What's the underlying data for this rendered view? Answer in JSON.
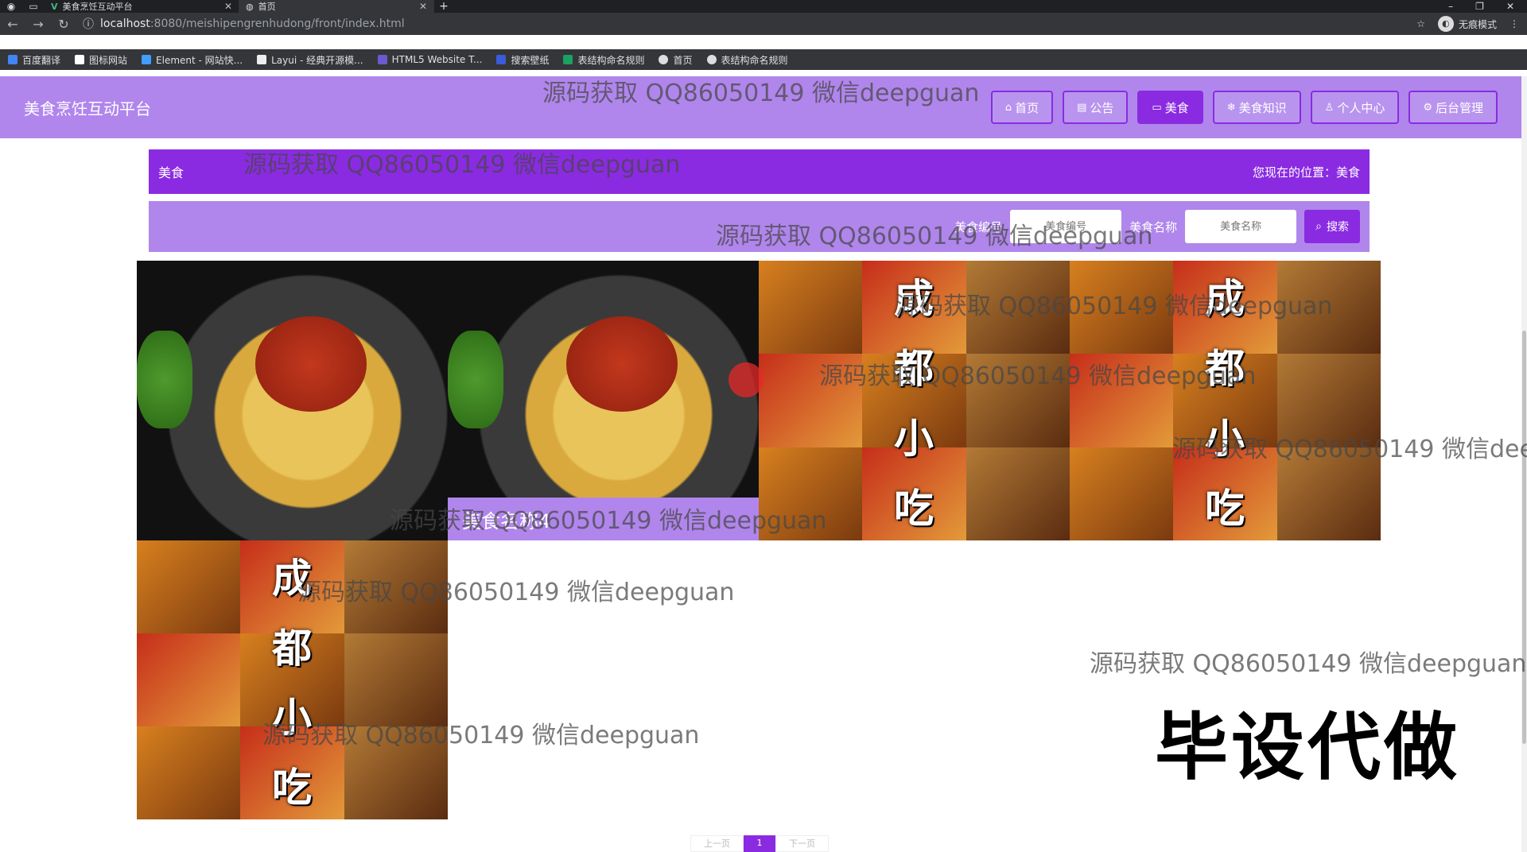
{
  "browser": {
    "tabs": [
      {
        "title": "美食烹饪互动平台"
      },
      {
        "title": "首页"
      }
    ],
    "url_host": "localhost",
    "url_path": ":8080/meishipengrenhudong/front/index.html",
    "incognito_label": "无痕模式",
    "bookmarks": [
      "百度翻译",
      "图标网站",
      "Element - 网站快...",
      "Layui - 经典开源模...",
      "HTML5 Website T...",
      "搜索壁纸",
      "表结构命名规则",
      "首页",
      "表结构命名规则"
    ]
  },
  "header": {
    "site_title": "美食烹饪互动平台",
    "nav": [
      {
        "label": "首页",
        "icon": "home-icon"
      },
      {
        "label": "公告",
        "icon": "notice-icon"
      },
      {
        "label": "美食",
        "icon": "food-icon",
        "active": true
      },
      {
        "label": "美食知识",
        "icon": "knowledge-icon"
      },
      {
        "label": "个人中心",
        "icon": "user-icon"
      },
      {
        "label": "后台管理",
        "icon": "admin-icon"
      }
    ]
  },
  "breadcrumb": {
    "left": "美食",
    "right": "您现在的位置：美食"
  },
  "search": {
    "field1_label": "美食编号",
    "field1_placeholder": "美食编号",
    "field2_label": "美食名称",
    "field2_placeholder": "美食名称",
    "button_label": "搜索"
  },
  "cards": [
    {
      "image": "pasta"
    },
    {
      "image": "pasta",
      "caption": "美食名称4"
    },
    {
      "image": "mosaic",
      "text": [
        "成",
        "都",
        "小",
        "吃"
      ]
    },
    {
      "image": "mosaic",
      "text": [
        "成",
        "都",
        "小",
        "吃"
      ]
    },
    {
      "image": "mosaic",
      "text": [
        "成",
        "都",
        "小",
        "吃"
      ]
    }
  ],
  "pagination": {
    "prev": "上一页",
    "current": "1",
    "next": "下一页"
  },
  "watermarks": {
    "text": "源码获取 QQ86050149 微信deepguan",
    "partial": "源码获取 QQ86050149 微信dee",
    "big": "毕设代做"
  },
  "colors": {
    "primary": "#8a2be2",
    "header_bg": "#b086ec"
  }
}
